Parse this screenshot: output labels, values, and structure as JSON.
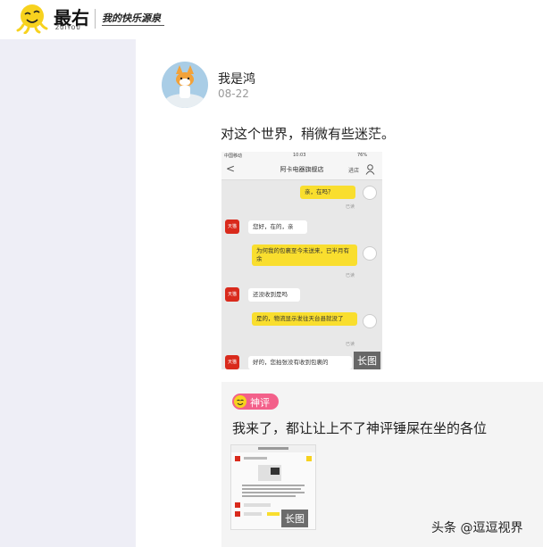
{
  "header": {
    "brand": "最右",
    "brand_sub": "ZUIYOU",
    "slogan": "我的快乐源泉"
  },
  "post": {
    "author": "我是鸿",
    "date": "08-22",
    "text": "对这个世界，稍微有些迷茫。",
    "long_image_badge": "长图",
    "screenshot": {
      "status_carrier": "中国移动",
      "status_time": "10:03",
      "status_battery": "76%",
      "nav_back": "<",
      "nav_title": "阿卡电器旗舰店",
      "nav_action": "进店",
      "messages": [
        {
          "side": "right",
          "text": "亲，在吗？",
          "read": "已读"
        },
        {
          "side": "left",
          "avatar": "天猫",
          "text": "您好，在的，亲"
        },
        {
          "side": "right",
          "text": "为何我的包裹至今未送来，已半月有余",
          "read": "已读"
        },
        {
          "side": "left",
          "avatar": "天猫",
          "text": "还没收到是吗"
        },
        {
          "side": "right",
          "text": "是的，物流显示发往天台县就没了",
          "read": "已读"
        },
        {
          "side": "left",
          "avatar": "天猫",
          "text": "好的，您拍张没有收到包裹的"
        }
      ]
    }
  },
  "comment": {
    "tag": "神评",
    "text": "我来了，都让让上不了神评锤屎在坐的各位",
    "long_image_badge": "长图"
  },
  "watermark": "头条 @逗逗视界",
  "colors": {
    "accent_yellow": "#f9de2e",
    "tag_pink": "#f3608a",
    "tmall_red": "#d92a1c",
    "sidebar_bg": "#eeeef6"
  }
}
